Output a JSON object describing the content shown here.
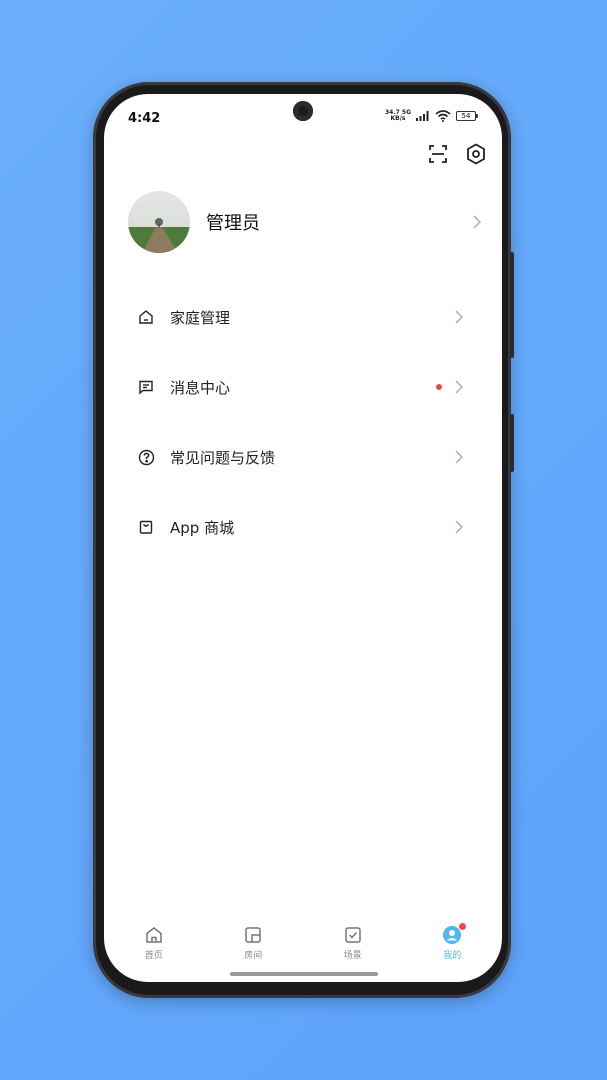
{
  "status_bar": {
    "time": "4:42",
    "net_speed_value": "34.7",
    "net_speed_unit": "KB/s",
    "network_type": "5G",
    "battery_level": "54"
  },
  "profile": {
    "name": "管理员"
  },
  "menu": {
    "items": [
      {
        "label": "家庭管理",
        "icon": "home-icon",
        "has_badge": false
      },
      {
        "label": "消息中心",
        "icon": "message-icon",
        "has_badge": true
      },
      {
        "label": "常见问题与反馈",
        "icon": "help-icon",
        "has_badge": false
      },
      {
        "label": "App 商城",
        "icon": "shopping-bag-icon",
        "has_badge": false
      }
    ]
  },
  "tabbar": {
    "tabs": [
      {
        "label": "首页",
        "icon": "home-icon",
        "active": false
      },
      {
        "label": "房间",
        "icon": "room-icon",
        "active": false
      },
      {
        "label": "场景",
        "icon": "scene-check-icon",
        "active": false
      },
      {
        "label": "我的",
        "icon": "user-icon",
        "active": true
      }
    ]
  },
  "colors": {
    "accent": "#4fb8ee",
    "badge": "#f04848",
    "background": "#6aaefb"
  }
}
